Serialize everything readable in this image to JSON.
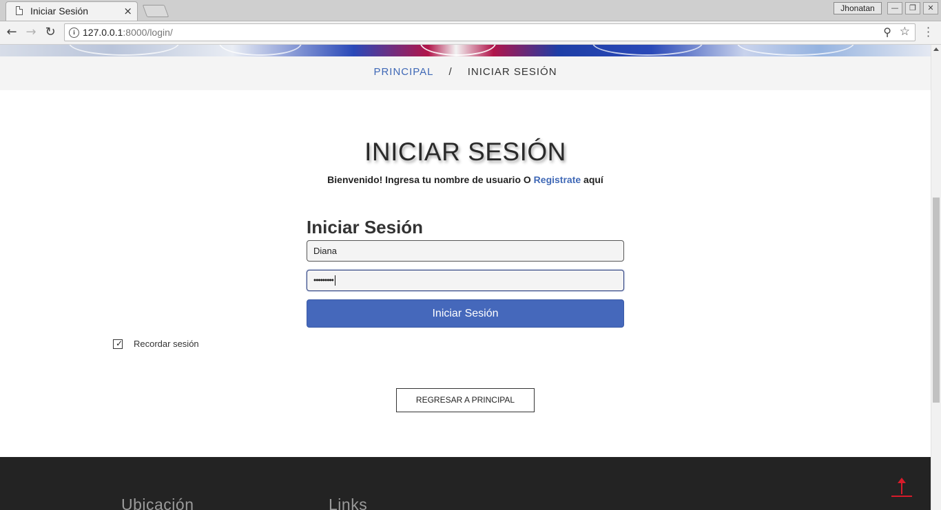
{
  "browser": {
    "tab_title": "Iniciar Sesión",
    "tab_close": "×",
    "profile_name": "Jhonatan",
    "url_host": "127.0.0.1",
    "url_rest": ":8000/login/",
    "window_buttons": [
      "—",
      "❐",
      "✕"
    ],
    "icons": [
      "back-arrow-icon",
      "forward-arrow-icon",
      "reload-icon",
      "info-icon",
      "zoom-icon",
      "star-icon",
      "menu-icon"
    ]
  },
  "breadcrumb": {
    "home": "PRINCIPAL",
    "separator": "/",
    "current": "INICIAR SESIÓN"
  },
  "header": {
    "title": "INICIAR SESIÓN",
    "welcome_prefix": "Bienvenido! Ingresa tu nombre de usuario O ",
    "register_link": "Registrate",
    "welcome_suffix": " aquí"
  },
  "form": {
    "heading": "Iniciar Sesión",
    "username_value": "Diana",
    "password_value": "•••••••••",
    "submit_label": "Iniciar Sesión",
    "remember_label": "Recordar sesión",
    "remember_checked": true
  },
  "back_button": "REGRESAR A PRINCIPAL",
  "footer": {
    "col1_title": "Ubicación",
    "col2_title": "Links"
  },
  "colors": {
    "accent": "#4568bb",
    "link": "#3f68b6",
    "footer_bg": "#232323",
    "to_top_arrow": "#d81b2a"
  }
}
